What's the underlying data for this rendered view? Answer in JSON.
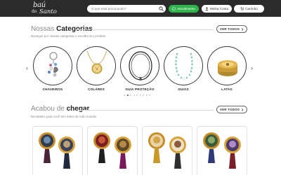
{
  "header": {
    "logo_line1": "baú",
    "logo_line2": "Santo",
    "logo_mark": "do",
    "search_placeholder": "O que está procurando?",
    "whatsapp_label": "Atendimento",
    "account_label": "Minha Conta",
    "cart_label": "Carrinho",
    "colors": {
      "bar": "#2b2b2b",
      "whatsapp": "#2fb34a"
    }
  },
  "categories_section": {
    "title_light": "Nossas",
    "title_bold": "Categorias",
    "subtitle": "Navegue por nossas categorias e escolha seu produto.",
    "see_all_label": "VER TODOS",
    "items": [
      {
        "label": "CHAVEIROS",
        "icon": "keychain-image"
      },
      {
        "label": "COLARES",
        "icon": "necklace-image"
      },
      {
        "label": "GUIA PROTEÇÃO",
        "icon": "protection-guide-image"
      },
      {
        "label": "GUIAS",
        "icon": "beaded-guide-image"
      },
      {
        "label": "LATAS",
        "icon": "tin-image"
      }
    ],
    "carousel_pages": 9,
    "carousel_active": 1
  },
  "new_section": {
    "title_light": "Acabou de",
    "title_bold": "chegar",
    "subtitle": "Novidades para você tem antes de todo mundo!",
    "see_all_label": "VER TODOS",
    "products": [
      {
        "icon": "tassel-medallion-image"
      },
      {
        "icon": "tassel-medallion-image"
      },
      {
        "icon": "tassel-medallion-image"
      },
      {
        "icon": "tassel-medallion-image"
      }
    ]
  }
}
